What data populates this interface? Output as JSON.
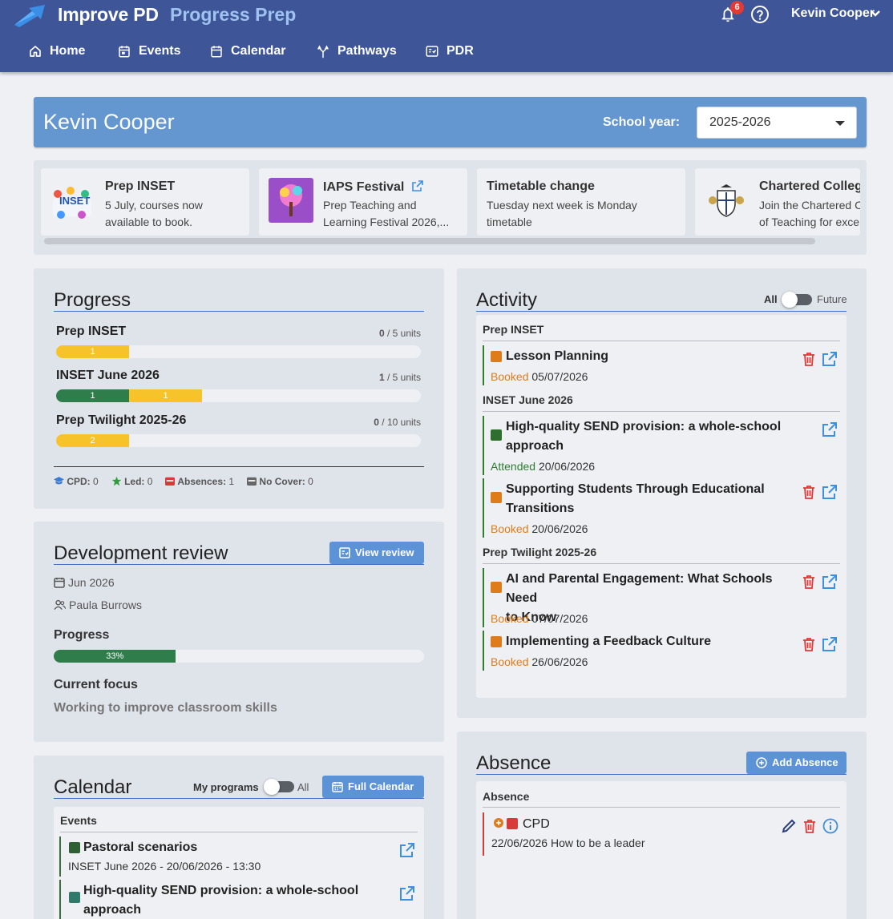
{
  "header": {
    "brand": "Improve PD",
    "product": "Progress Prep",
    "notifications_count": "6",
    "user_name": "Kevin Cooper"
  },
  "nav": [
    {
      "label": "Home",
      "icon": "home-icon"
    },
    {
      "label": "Events",
      "icon": "events-icon"
    },
    {
      "label": "Calendar",
      "icon": "calendar-icon"
    },
    {
      "label": "Pathways",
      "icon": "pathways-icon"
    },
    {
      "label": "PDR",
      "icon": "pdr-icon"
    }
  ],
  "profile": {
    "name": "Kevin Cooper",
    "school_year_label": "School year:",
    "school_year_value": "2025-2026"
  },
  "news": [
    {
      "title": "Prep INSET",
      "line1": "5 July, courses now",
      "line2": "available to book."
    },
    {
      "title": "IAPS Festival",
      "line1": "Prep Teaching and",
      "line2": "Learning Festival 2026,..."
    },
    {
      "title": "Timetable change",
      "line1": "Tuesday next week is Monday",
      "line2": "timetable"
    },
    {
      "title": "Chartered College",
      "line1": "Join the Chartered C",
      "line2": "of Teaching for exce"
    }
  ],
  "progress": {
    "title": "Progress",
    "programs": [
      {
        "name": "Prep INSET",
        "done": "0",
        "total": "/ 5 units",
        "green": 0,
        "yellow": 1,
        "green_label": "",
        "yellow_label": "1",
        "max": 5
      },
      {
        "name": "INSET June 2026",
        "done": "1",
        "total": "/ 5 units",
        "green": 1,
        "yellow": 1,
        "green_label": "1",
        "yellow_label": "1",
        "max": 5
      },
      {
        "name": "Prep Twilight 2025-26",
        "done": "0",
        "total": "/ 10 units",
        "green": 0,
        "yellow": 2,
        "green_label": "",
        "yellow_label": "2",
        "max": 10
      }
    ],
    "stats": {
      "cpd_label": "CPD:",
      "cpd": "0",
      "led_label": "Led:",
      "led": "0",
      "abs_label": "Absences:",
      "abs": "1",
      "nocover_label": "No Cover:",
      "nocover": "0"
    }
  },
  "review": {
    "title": "Development review",
    "button": "View review",
    "date": "Jun 2026",
    "reviewer": "Paula Burrows",
    "progress_label": "Progress",
    "progress_value": "33%",
    "progress_fraction": 0.33,
    "focus_label": "Current focus",
    "focus_text": "Working to improve classroom skills"
  },
  "calendar": {
    "title": "Calendar",
    "toggle_left": "My programs",
    "toggle_right": "All",
    "button": "Full Calendar",
    "group": "Events",
    "items": [
      {
        "title": "Pastoral scenarios",
        "meta": "INSET June 2026 - 20/06/2026 - 13:30"
      },
      {
        "title": "High-quality SEND provision: a whole-school",
        "title2": "approach"
      }
    ]
  },
  "activity": {
    "title": "Activity",
    "toggle_left": "All",
    "toggle_right": "Future",
    "groups": [
      {
        "name": "Prep INSET",
        "items": [
          {
            "title": "Lesson Planning",
            "title2": "",
            "status": "Booked",
            "date": "05/07/2026"
          }
        ]
      },
      {
        "name": "INSET June 2026",
        "items": [
          {
            "title": "High-quality SEND provision: a whole-school",
            "title2": "approach",
            "status": "Attended",
            "date": "20/06/2026"
          },
          {
            "title": "Supporting Students Through Educational",
            "title2": "Transitions",
            "status": "Booked",
            "date": "20/06/2026"
          }
        ]
      },
      {
        "name": "Prep Twilight 2025-26",
        "items": [
          {
            "title": "AI and Parental Engagement: What Schools Need",
            "title2": "to Know",
            "status": "Booked",
            "date": "07/07/2026"
          },
          {
            "title": "Implementing a Feedback Culture",
            "title2": "",
            "status": "Booked",
            "date": "26/06/2026"
          }
        ]
      }
    ]
  },
  "absence": {
    "title": "Absence",
    "button": "Add Absence",
    "group": "Absence",
    "item": {
      "type": "CPD",
      "date": "22/06/2026",
      "reason": "How to be a leader"
    }
  },
  "colors": {
    "header": "#3e5597",
    "accent": "#5b93d6",
    "booked": "#e07b1a",
    "attended": "#2e7d32",
    "delete": "#e53935",
    "progress_green": "#2e7d4a",
    "progress_yellow": "#f6c32a"
  }
}
